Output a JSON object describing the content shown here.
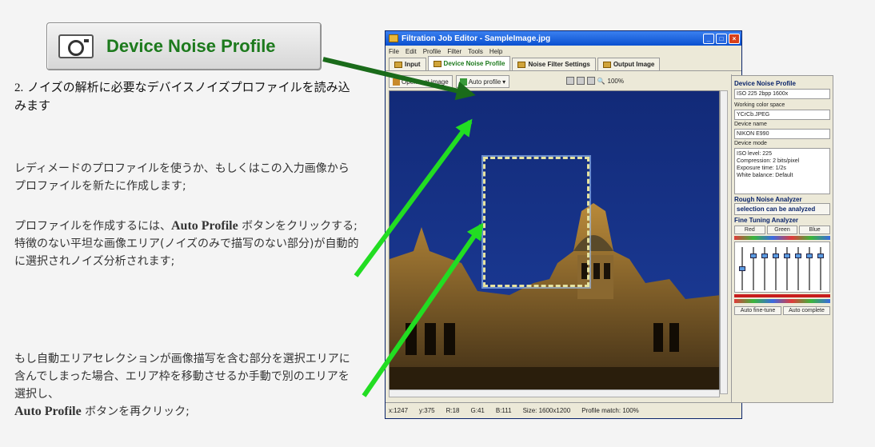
{
  "callout": {
    "label": "Device Noise Profile",
    "icon": "camera-icon"
  },
  "text": {
    "step_number": "2.",
    "step_heading": "ノイズの解析に必要なデバイスノイズプロファイルを読み込みます",
    "para1": "レディメードのプロファイルを使うか、もしくはこの入力画像からプロファイルを新たに作成します;",
    "para2_pre": "プロファイルを作成するには、",
    "para2_button": "Auto Profile",
    "para2_post": " ボタンをクリックする;",
    "para2b": "特徴のない平坦な画像エリア(ノイズのみで描写のない部分)が自動的に選択されノイズ分析されます;",
    "para3_pre": "もし自動エリアセレクションが画像描写を含む部分を選択エリアに含んでしまった場合、エリア枠を移動させるか手動で別のエリアを選択し、",
    "para3_button": "Auto Profile",
    "para3_post": " ボタンを再クリック;"
  },
  "window": {
    "title": "Filtration Job Editor - SampleImage.jpg",
    "menu": [
      "File",
      "Edit",
      "Profile",
      "Filter",
      "Tools",
      "Help"
    ],
    "tabs": [
      "Input",
      "Device Noise Profile",
      "Noise Filter Settings",
      "Output Image"
    ],
    "toolbar": {
      "open": "Open test image",
      "auto": "Auto profile",
      "zoom": "100%"
    },
    "status": {
      "x": "x:1247",
      "y": "y:375",
      "r": "R:18",
      "g": "G:41",
      "b": "B:111",
      "size": "Size: 1600x1200",
      "match": "Profile match: 100%"
    },
    "panel": {
      "title": "Device Noise Profile",
      "profile_select": "ISO 225 2bpp 1600x",
      "working_space_label": "Working color space",
      "working_space": "YCrCb.JPEG",
      "device_name_label": "Device name",
      "device_name": "NIKON E990",
      "device_mode_label": "Device mode",
      "device_mode_lines": [
        "ISO level: 225",
        "Compression: 2 bits/pixel",
        "Exposure time: 1/2s",
        "White balance: Default"
      ],
      "rough_title": "Rough Noise Analyzer",
      "rough_status": "selection can be analyzed",
      "fine_title": "Fine Tuning Analyzer",
      "fine_tabs": [
        "Red",
        "Green",
        "Blue"
      ],
      "btn_auto_fine": "Auto fine-tune",
      "btn_auto_complete": "Auto complete"
    }
  }
}
